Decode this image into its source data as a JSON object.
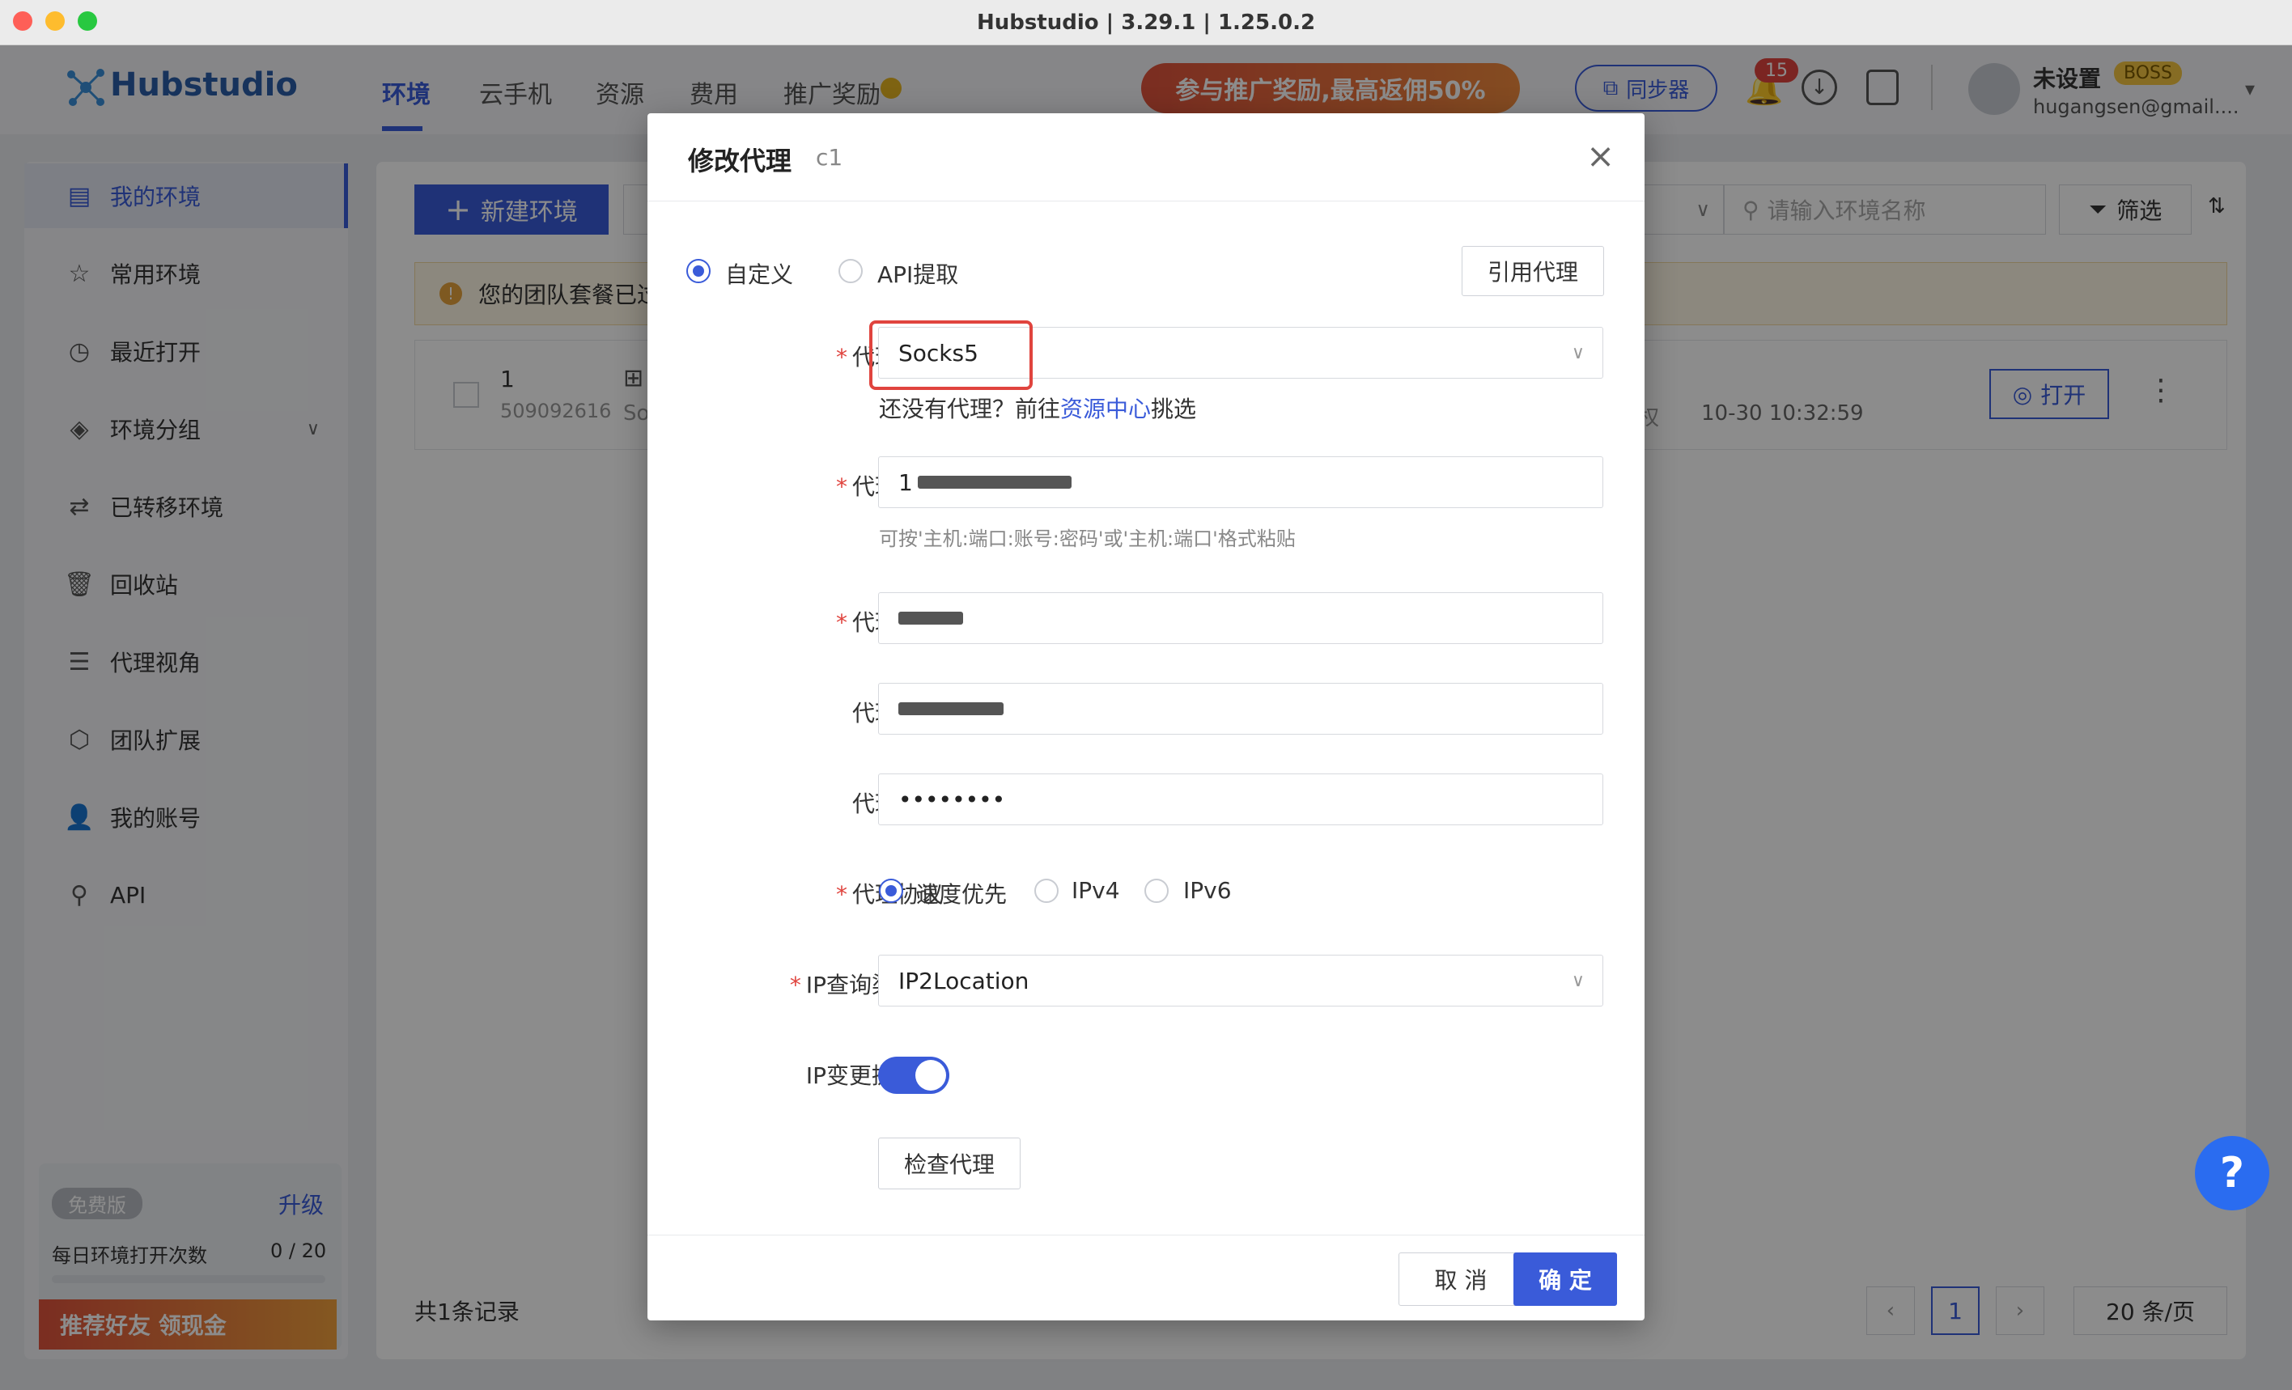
{
  "window": {
    "title": "Hubstudio | 3.29.1 | 1.25.0.2"
  },
  "app": {
    "logo_text": "Hubstudio"
  },
  "topnav": {
    "tabs": [
      {
        "label": "环境"
      },
      {
        "label": "云手机"
      },
      {
        "label": "资源"
      },
      {
        "label": "费用"
      },
      {
        "label": "推广奖励"
      }
    ],
    "promo_banner": "参与推广奖励,最高返佣50%",
    "sync_button": "同步器",
    "notification_count": "15",
    "user": {
      "name": "未设置",
      "role": "BOSS",
      "email": "hugangsen@gmail...."
    }
  },
  "sidebar": {
    "items": [
      {
        "label": "我的环境",
        "icon": "store-icon"
      },
      {
        "label": "常用环境",
        "icon": "star-icon"
      },
      {
        "label": "最近打开",
        "icon": "clock-icon"
      },
      {
        "label": "环境分组",
        "icon": "layers-icon"
      },
      {
        "label": "已转移环境",
        "icon": "transfer-icon"
      },
      {
        "label": "回收站",
        "icon": "trash-icon"
      },
      {
        "label": "代理视角",
        "icon": "proxy-view-icon"
      },
      {
        "label": "团队扩展",
        "icon": "cube-icon"
      },
      {
        "label": "我的账号",
        "icon": "user-icon"
      },
      {
        "label": "API",
        "icon": "api-icon"
      }
    ],
    "plan_badge": "免费版",
    "upgrade_link": "升级",
    "daily_open_label": "每日环境打开次数",
    "daily_open_value": "0 / 20",
    "referral_banner": "推荐好友 领现金"
  },
  "main": {
    "new_env_button": "新建环境",
    "search_placeholder": "请输入环境名称",
    "filter_button": "筛选",
    "notice_text": "您的团队套餐已过",
    "row": {
      "index": "1",
      "id": "509092616",
      "type_short": "So",
      "time": "10-30 10:32:59",
      "auth_short": "权",
      "open_button": "打开"
    },
    "total_records": "共1条记录",
    "page": "1",
    "page_size": "20 条/页"
  },
  "modal": {
    "title": "修改代理",
    "subtitle": "c1",
    "mode_custom": "自定义",
    "mode_api": "API提取",
    "quote_proxy_button": "引用代理",
    "proxy_type_label": "代理类型",
    "proxy_type_value": "Socks5",
    "no_proxy_prefix": "还没有代理？前往",
    "no_proxy_link": "资源中心",
    "no_proxy_suffix": "挑选",
    "host_label": "代理主机",
    "host_value_visible": "1",
    "host_hint": "可按'主机:端口:账号:密码'或'主机:端口'格式粘贴",
    "port_label": "代理端口",
    "account_label": "代理账号",
    "password_label": "代理密码",
    "password_value": "••••••••",
    "protocol_label": "代理协议",
    "protocol_options": [
      "速度优先",
      "IPv4",
      "IPv6"
    ],
    "ip_channel_label": "IP查询渠道",
    "ip_channel_value": "IP2Location",
    "ip_change_label": "IP变更提醒",
    "ip_change_enabled": true,
    "check_proxy_button": "检查代理",
    "cancel_button": "取 消",
    "confirm_button": "确 定"
  },
  "colors": {
    "accent": "#3a5bd9",
    "required": "#e0443e",
    "highlight_box": "#e0443e"
  }
}
